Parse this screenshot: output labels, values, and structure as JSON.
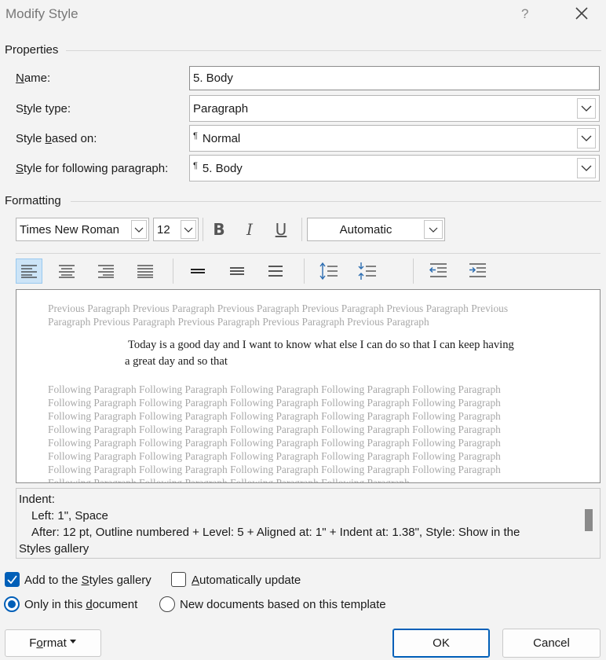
{
  "window": {
    "title": "Modify Style",
    "help": "?",
    "close_icon": "close-icon"
  },
  "properties": {
    "header": "Properties",
    "name_label": "Name:",
    "name_value": "5. Body",
    "style_type_label": "Style type:",
    "style_type_value": "Paragraph",
    "based_on_label": "Style based on:",
    "based_on_value": "Normal",
    "following_label": "Style for following paragraph:",
    "following_value": "5. Body",
    "paragraph_mark": "¶"
  },
  "formatting": {
    "header": "Formatting",
    "font": "Times New Roman",
    "size": "12",
    "bold": "B",
    "italic": "I",
    "underline": "U",
    "color": "Automatic"
  },
  "preview": {
    "previous": "Previous Paragraph Previous Paragraph Previous Paragraph Previous Paragraph Previous Paragraph Previous Paragraph Previous Paragraph Previous Paragraph Previous Paragraph Previous Paragraph",
    "main_line1": "Today is a good day and I want to know what else I can do so that I can keep having",
    "main_line2": "a great day and so that",
    "following_line": "Following Paragraph Following Paragraph Following Paragraph Following Paragraph Following Paragraph",
    "following_last": "Following Paragraph Following Paragraph Following Paragraph Following Paragraph"
  },
  "description": {
    "line1": "Indent:",
    "line2": "Left:  1\", Space",
    "line3": "After:  12 pt, Outline numbered + Level: 5 + Aligned at:  1\" + Indent at:  1.38\", Style: Show in the",
    "line4": "Styles gallery"
  },
  "options": {
    "add_to_gallery": "Add to the Styles gallery",
    "add_to_gallery_checked": true,
    "auto_update": "Automatically update",
    "auto_update_checked": false,
    "only_this_doc": "Only in this document",
    "new_docs": "New documents based on this template"
  },
  "buttons": {
    "format": "Format",
    "ok": "OK",
    "cancel": "Cancel"
  },
  "colors": {
    "accent": "#005fb8",
    "preview_gray": "#a8a8a8"
  }
}
